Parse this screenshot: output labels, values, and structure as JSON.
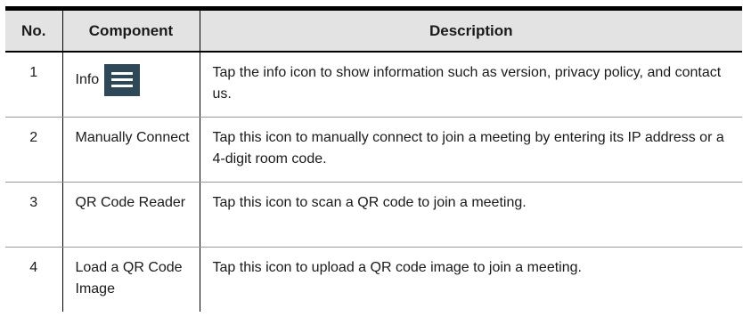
{
  "table": {
    "headers": {
      "no": "No.",
      "component": "Component",
      "description": "Description"
    },
    "rows": [
      {
        "no": "1",
        "component": "Info",
        "icon": "menu-icon",
        "description": "Tap the info icon to show information such as version, privacy policy, and contact us."
      },
      {
        "no": "2",
        "component": "Manually Connect",
        "description": "Tap this icon to manually connect to join a meeting by entering its IP address or a 4-digit room code."
      },
      {
        "no": "3",
        "component": "QR Code Reader",
        "description": "Tap this icon to scan a QR code to join a meeting."
      },
      {
        "no": "4",
        "component": "Load a QR Code Image",
        "description": "Tap this icon to upload a QR code image to join a meeting."
      }
    ]
  },
  "colors": {
    "header_background": "#e3e3e3",
    "icon_background": "#2f4858"
  }
}
